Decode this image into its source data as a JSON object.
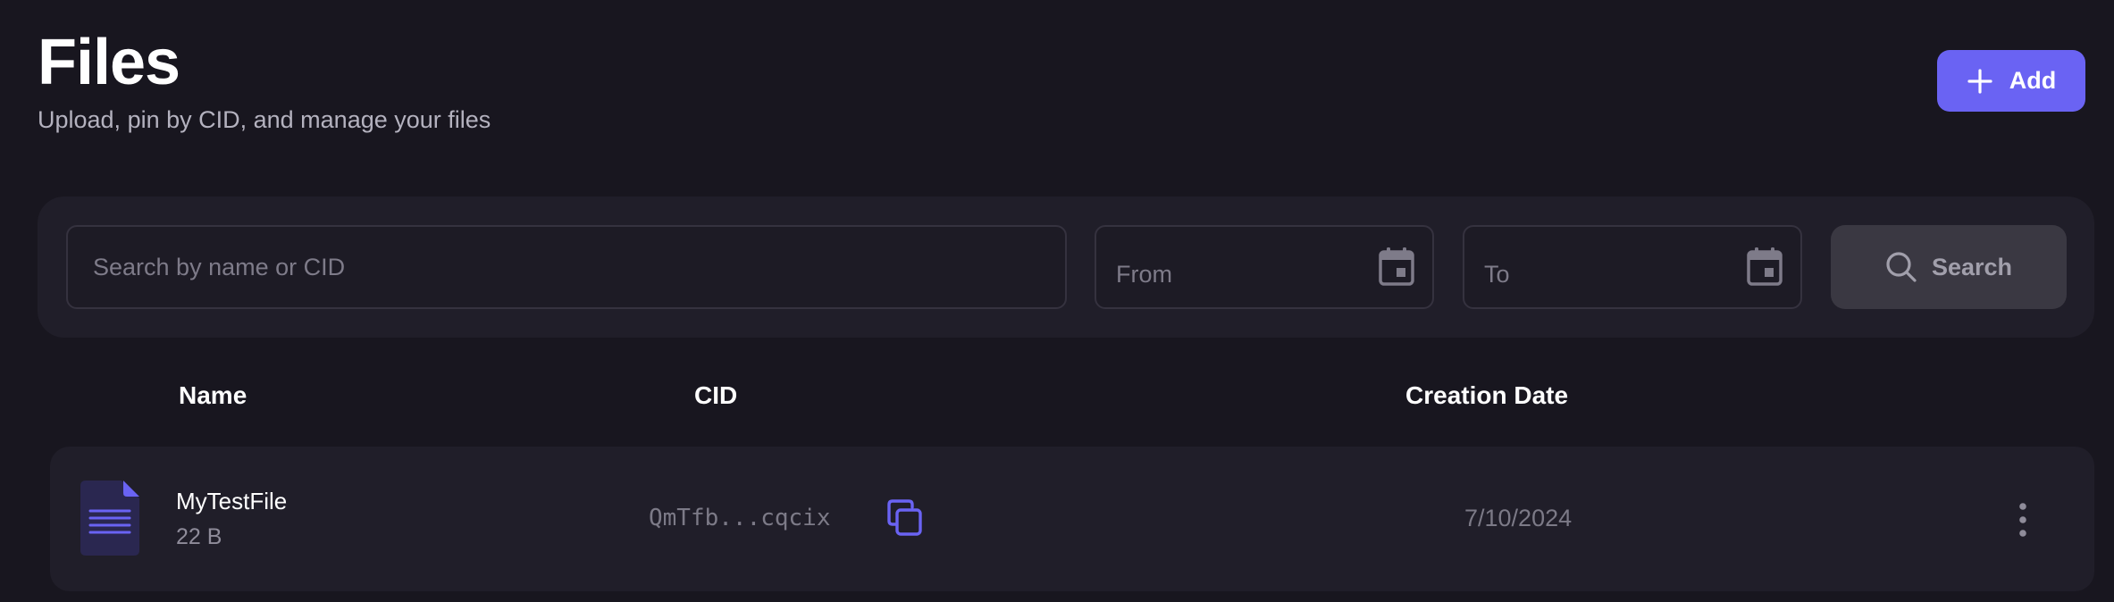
{
  "header": {
    "title": "Files",
    "subtitle": "Upload, pin by CID, and manage your files",
    "add_label": "Add"
  },
  "filters": {
    "search_placeholder": "Search by name or CID",
    "from_placeholder": "From",
    "to_placeholder": "To",
    "search_label": "Search"
  },
  "table": {
    "columns": [
      "Name",
      "CID",
      "Creation Date"
    ],
    "rows": [
      {
        "name": "MyTestFile",
        "size": "22 B",
        "cid": "QmTfb...cqcix",
        "date": "7/10/2024"
      }
    ]
  },
  "icons": {
    "add": "plus-icon",
    "calendar": "calendar-icon",
    "search": "search-icon",
    "file": "document-icon",
    "copy": "copy-icon",
    "more": "more-vertical-icon"
  },
  "colors": {
    "accent": "#6a63f3",
    "background": "#18161f",
    "panel": "#201e29"
  }
}
